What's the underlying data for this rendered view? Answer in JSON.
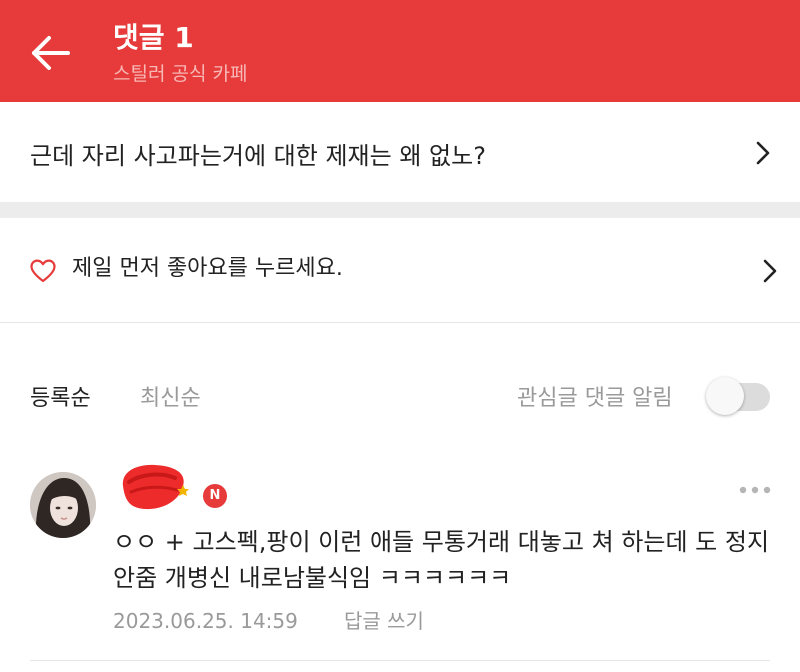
{
  "header": {
    "title": "댓글 1",
    "subtitle": "스틸러 공식 카페",
    "background_color": "#e63b3a",
    "back_icon": "arrow-left-icon"
  },
  "post": {
    "title": "근데 자리 사고파는거에 대한 제재는 왜 없노?",
    "chevron_icon": "chevron-right-icon"
  },
  "like": {
    "text": "제일 먼저 좋아요를 누르세요.",
    "heart_icon": "heart-outline-icon",
    "heart_color": "#e63b3a"
  },
  "sort": {
    "registered_label": "등록순",
    "newest_label": "최신순",
    "alarm_label": "관심글 댓글 알림",
    "alarm_enabled": false
  },
  "comments": [
    {
      "author_badge": "N",
      "text": "ㅇㅇ + 고스펙,팡이 이런 애들 무통거래 대놓고 쳐 하는데 도 정지 안줌 개병신 내로남불식임 ㅋㅋㅋㅋㅋㅋ",
      "date": "2023.06.25. 14:59",
      "reply_label": "답글 쓰기",
      "more_icon": "more-dots-icon"
    }
  ]
}
